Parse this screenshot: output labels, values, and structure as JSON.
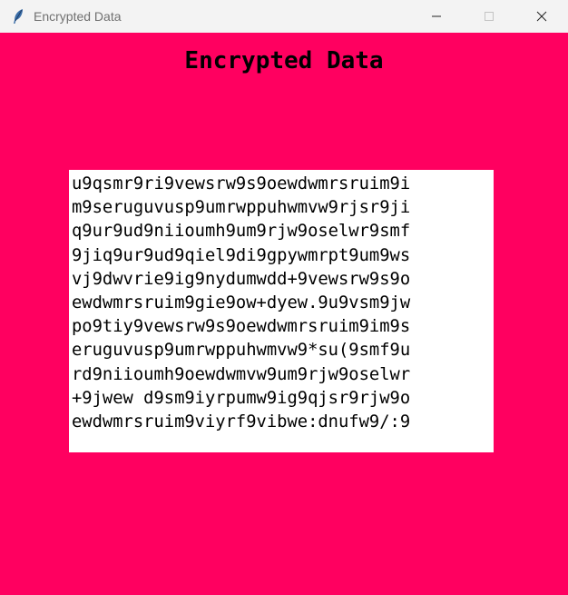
{
  "window": {
    "title": "Encrypted Data",
    "icon": "feather-icon",
    "controls": [
      "minimize-icon",
      "maximize-icon",
      "close-icon"
    ],
    "background_color": "#ff0060"
  },
  "main": {
    "heading": "Encrypted Data",
    "text_lines": [
      "u9qsmr9ri9vewsrw9s9oewdwmrsruim9i",
      "m9seruguvusp9umrwppuhwmvw9rjsr9ji",
      "q9ur9ud9niioumh9um9rjw9oselwr9smf",
      "9jiq9ur9ud9qiel9di9gpywmrpt9um9ws",
      "vj9dwvrie9ig9nydumwdd+9vewsrw9s9o",
      "ewdwmrsruim9gie9ow+dyew.9u9vsm9jw",
      "po9tiy9vewsrw9s9oewdwmrsruim9im9s",
      "eruguvusp9umrwppuhwmvw9*su(9smf9u",
      "rd9niioumh9oewdwmvw9um9rjw9oselwr",
      "+9jwew d9sm9iyrpumw9ig9qjsr9rjw9o",
      "ewdwmrsruim9viyrf9vibwe:dnufw9/:9"
    ]
  }
}
